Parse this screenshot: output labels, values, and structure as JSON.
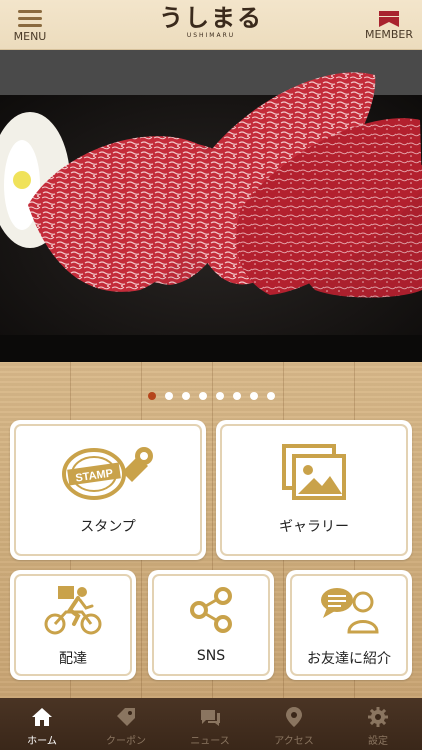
{
  "header": {
    "menu_label": "MENU",
    "logo_text": "うしまる",
    "logo_sub": "USHIMARU",
    "member_label": "MEMBER"
  },
  "carousel": {
    "total": 8,
    "active_index": 0
  },
  "tiles": [
    {
      "label": "スタンプ",
      "icon": "stamp-icon",
      "icon_text": "STAMP"
    },
    {
      "label": "ギャラリー",
      "icon": "gallery-icon"
    },
    {
      "label": "配達",
      "icon": "delivery-bike-icon"
    },
    {
      "label": "SNS",
      "icon": "share-icon"
    },
    {
      "label": "お友達に紹介",
      "icon": "invite-friend-icon"
    }
  ],
  "tabs": [
    {
      "label": "ホーム",
      "icon": "home-icon",
      "active": true
    },
    {
      "label": "クーポン",
      "icon": "coupon-tag-icon",
      "active": false
    },
    {
      "label": "ニュース",
      "icon": "news-chat-icon",
      "active": false
    },
    {
      "label": "アクセス",
      "icon": "map-pin-icon",
      "active": false
    },
    {
      "label": "設定",
      "icon": "gear-icon",
      "active": false
    }
  ],
  "colors": {
    "accent_gold": "#c9a24a",
    "header_bg": "#f3e5cb",
    "tab_bg": "#3a2719",
    "active_dot": "#b5451b",
    "member_red": "#a8232e"
  }
}
